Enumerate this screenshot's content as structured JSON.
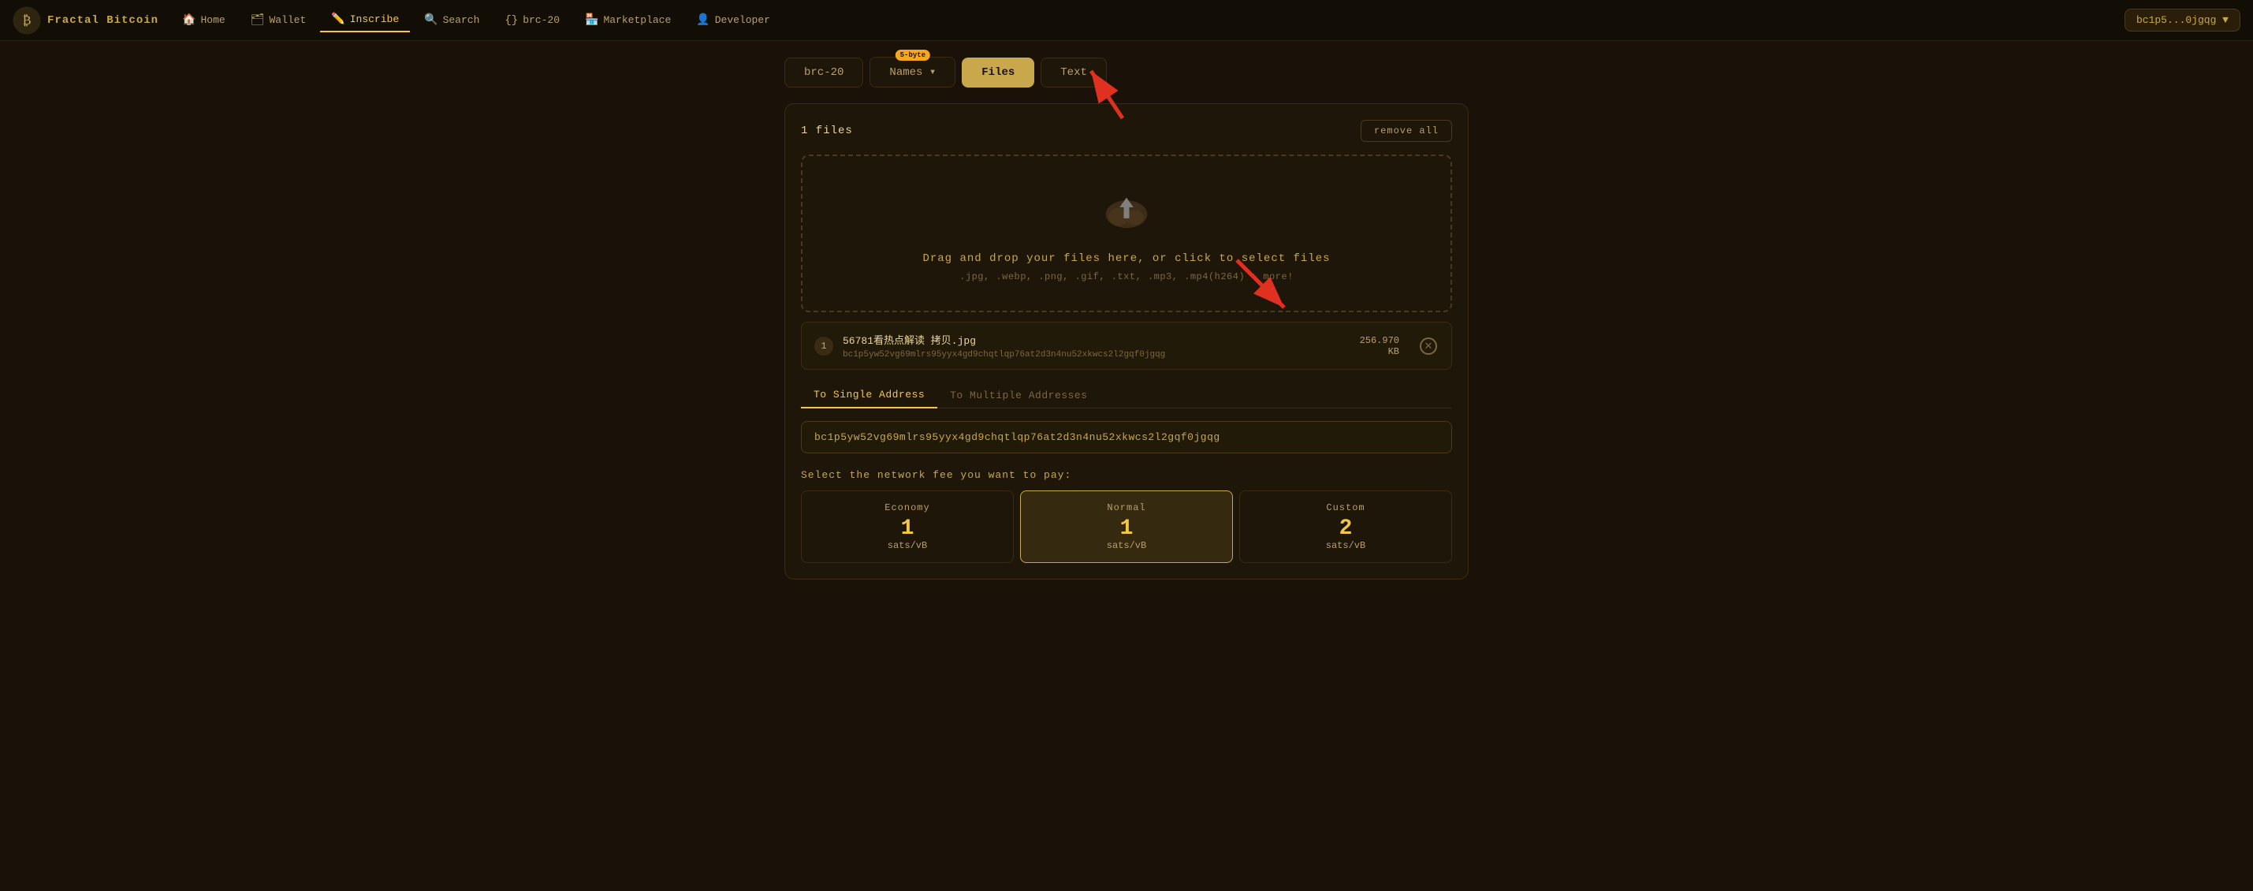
{
  "brand": {
    "name": "Fractal Bitcoin"
  },
  "nav": {
    "items": [
      {
        "id": "home",
        "label": "Home",
        "icon": "🏠"
      },
      {
        "id": "wallet",
        "label": "Wallet",
        "icon": "🗂"
      },
      {
        "id": "inscribe",
        "label": "Inscribe",
        "icon": "✏️",
        "active": true
      },
      {
        "id": "search",
        "label": "Search",
        "icon": "🔍"
      },
      {
        "id": "brc-20",
        "label": "brc-20",
        "icon": "{}"
      },
      {
        "id": "marketplace",
        "label": "Marketplace",
        "icon": "🏪"
      },
      {
        "id": "developer",
        "label": "Developer",
        "icon": "👤"
      }
    ],
    "wallet_btn": "bc1p5...0jgqg ▼"
  },
  "tabs": [
    {
      "id": "brc-20",
      "label": "brc-20",
      "badge": null,
      "active": false
    },
    {
      "id": "names",
      "label": "Names ▾",
      "badge": "5-byte",
      "active": false
    },
    {
      "id": "files",
      "label": "Files",
      "badge": null,
      "active": true
    },
    {
      "id": "text",
      "label": "Text",
      "badge": null,
      "active": false
    }
  ],
  "panel": {
    "files_count": "1 files",
    "remove_all_label": "remove all",
    "drop_zone": {
      "main_text": "Drag and drop your files here, or click to select files",
      "sub_text": ".jpg, .webp, .png, .gif, .txt, .mp3, .mp4(h264) + more!"
    },
    "file_item": {
      "index": "1",
      "name": "56781看热点解读 拷贝.jpg",
      "address": "bc1p5yw52vg69mlrs95yyx4gd9chqtlqp76at2d3n4nu52xkwcs2l2gqf0jgqg",
      "size_line1": "256.970",
      "size_line2": "KB"
    },
    "addr_tabs": [
      {
        "id": "single",
        "label": "To Single Address",
        "active": true
      },
      {
        "id": "multiple",
        "label": "To Multiple Addresses",
        "active": false
      }
    ],
    "address_value": "bc1p5yw52vg69mlrs95yyx4gd9chqtlqp76at2d3n4nu52xkwcs2l2gqf0jgqg",
    "fee_label": "Select the network fee you want to pay:",
    "fee_options": [
      {
        "id": "economy",
        "label": "Economy",
        "amount": "1",
        "unit": "sats/vB",
        "active": false
      },
      {
        "id": "normal",
        "label": "Normal",
        "amount": "1",
        "unit": "sats/vB",
        "active": true
      },
      {
        "id": "custom",
        "label": "Custom",
        "amount": "2",
        "unit": "sats/vB",
        "active": false
      }
    ]
  }
}
